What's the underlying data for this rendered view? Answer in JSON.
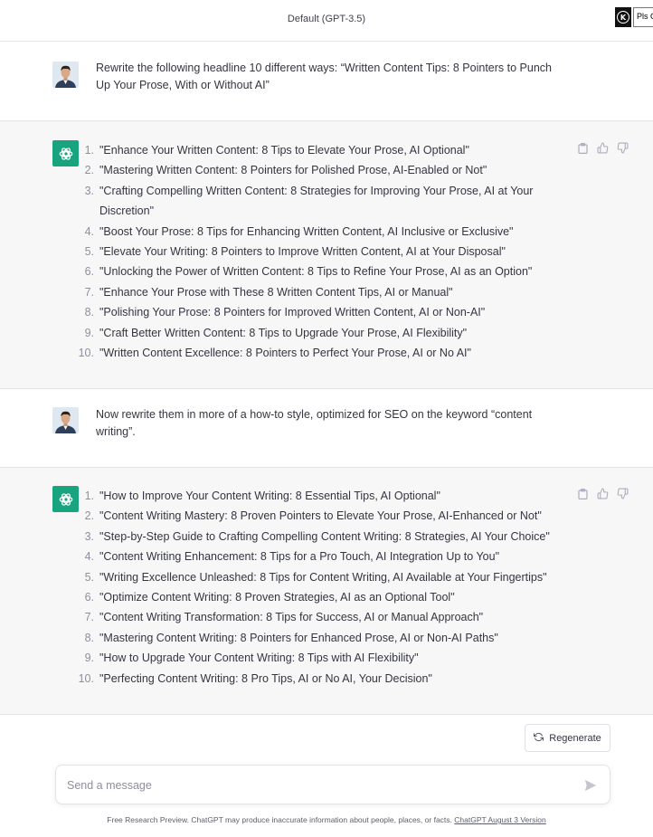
{
  "header": {
    "model_title": "Default (GPT-3.5)",
    "extension_letter": "K",
    "extension_text": "Pls C"
  },
  "conversation": [
    {
      "role": "user",
      "avatar_icon": "user-photo-avatar",
      "text": "Rewrite the following headline 10 different ways: “Written Content Tips: 8 Pointers to Punch Up Your Prose, With or Without AI”"
    },
    {
      "role": "assistant",
      "avatar_icon": "openai-logo-icon",
      "items": [
        {
          "num": "1.",
          "text": "\"Enhance Your Written Content: 8 Tips to Elevate Your Prose, AI Optional\""
        },
        {
          "num": "2.",
          "text": "\"Mastering Written Content: 8 Pointers for Polished Prose, AI-Enabled or Not\""
        },
        {
          "num": "3.",
          "text": "\"Crafting Compelling Written Content: 8 Strategies for Improving Your Prose, AI at Your Discretion\""
        },
        {
          "num": "4.",
          "text": "\"Boost Your Prose: 8 Tips for Enhancing Written Content, AI Inclusive or Exclusive\""
        },
        {
          "num": "5.",
          "text": "\"Elevate Your Writing: 8 Pointers to Improve Written Content, AI at Your Disposal\""
        },
        {
          "num": "6.",
          "text": "\"Unlocking the Power of Written Content: 8 Tips to Refine Your Prose, AI as an Option\""
        },
        {
          "num": "7.",
          "text": "\"Enhance Your Prose with These 8 Written Content Tips, AI or Manual\""
        },
        {
          "num": "8.",
          "text": "\"Polishing Your Prose: 8 Pointers for Improved Written Content, AI or Non-AI\""
        },
        {
          "num": "9.",
          "text": "\"Craft Better Written Content: 8 Tips to Upgrade Your Prose, AI Flexibility\""
        },
        {
          "num": "10.",
          "text": "\"Written Content Excellence: 8 Pointers to Perfect Your Prose, AI or No AI\""
        }
      ]
    },
    {
      "role": "user",
      "avatar_icon": "user-photo-avatar",
      "text": "Now rewrite them in more of a how-to style, optimized for SEO on the keyword “content writing”."
    },
    {
      "role": "assistant",
      "avatar_icon": "openai-logo-icon",
      "items": [
        {
          "num": "1.",
          "text": "\"How to Improve Your Content Writing: 8 Essential Tips, AI Optional\""
        },
        {
          "num": "2.",
          "text": "\"Content Writing Mastery: 8 Proven Pointers to Elevate Your Prose, AI-Enhanced or Not\""
        },
        {
          "num": "3.",
          "text": "\"Step-by-Step Guide to Crafting Compelling Content Writing: 8 Strategies, AI Your Choice\""
        },
        {
          "num": "4.",
          "text": "\"Content Writing Enhancement: 8 Tips for a Pro Touch, AI Integration Up to You\""
        },
        {
          "num": "5.",
          "text": "\"Writing Excellence Unleashed: 8 Tips for Content Writing, AI Available at Your Fingertips\""
        },
        {
          "num": "6.",
          "text": "\"Optimize Content Writing: 8 Proven Strategies, AI as an Optional Tool\""
        },
        {
          "num": "7.",
          "text": "\"Content Writing Transformation: 8 Tips for Success, AI or Manual Approach\""
        },
        {
          "num": "8.",
          "text": "\"Mastering Content Writing: 8 Pointers for Enhanced Prose, AI or Non-AI Paths\""
        },
        {
          "num": "9.",
          "text": "\"How to Upgrade Your Content Writing: 8 Tips with AI Flexibility\""
        },
        {
          "num": "10.",
          "text": "\"Perfecting Content Writing: 8 Pro Tips, AI or No AI, Your Decision\""
        }
      ]
    }
  ],
  "message_actions": {
    "icons": [
      "copy-icon",
      "thumbs-up-icon",
      "thumbs-down-icon"
    ]
  },
  "composer": {
    "regenerate_label": "Regenerate",
    "placeholder": "Send a message",
    "send_icon": "send-icon"
  },
  "footer": {
    "text": "Free Research Preview. ChatGPT may produce inaccurate information about people, places, or facts.",
    "link": "ChatGPT August 3 Version"
  },
  "colors": {
    "accent_green": "#19a37f",
    "assistant_bg": "#f7f7f8",
    "text": "#343541"
  }
}
